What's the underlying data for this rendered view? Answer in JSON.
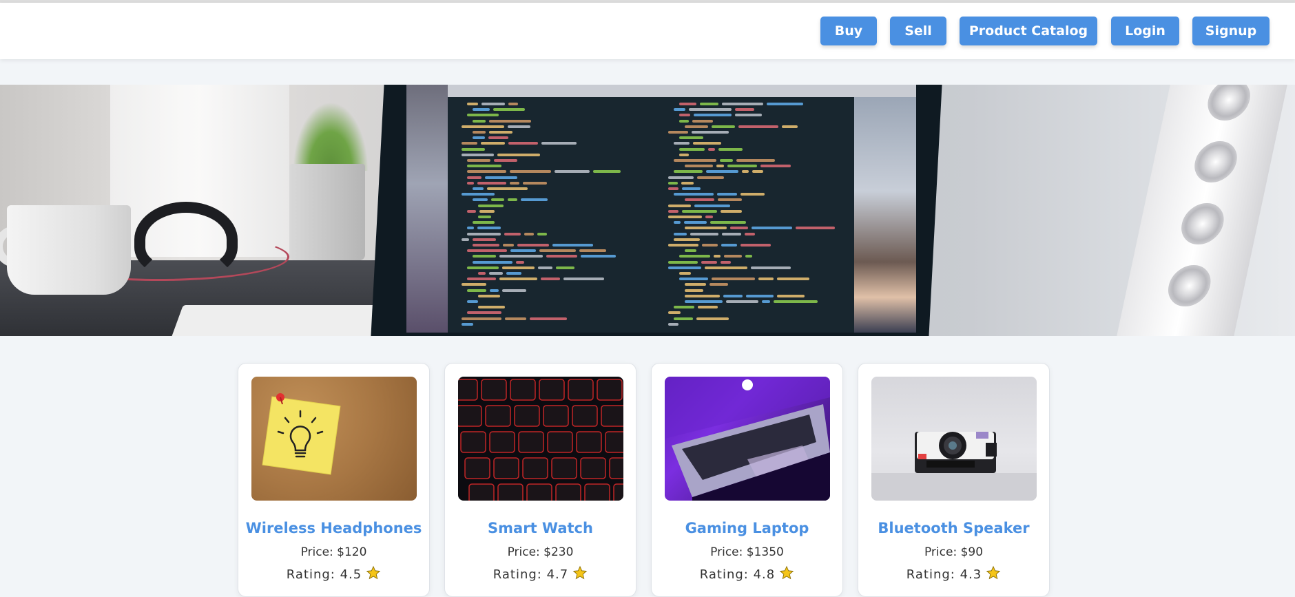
{
  "nav": {
    "buttons": [
      {
        "label": "Buy"
      },
      {
        "label": "Sell"
      },
      {
        "label": "Product Catalog"
      },
      {
        "label": "Login"
      },
      {
        "label": "Signup"
      }
    ]
  },
  "hero": {
    "image": "desk-with-laptop-showing-code-image"
  },
  "products": [
    {
      "name": "Wireless Headphones",
      "price": "Price: $120",
      "rating": "Rating: 4.5",
      "image": "lightbulb-sticky-note-image"
    },
    {
      "name": "Smart Watch",
      "price": "Price: $230",
      "rating": "Rating: 4.7",
      "image": "red-backlit-keyboard-image"
    },
    {
      "name": "Gaming Laptop",
      "price": "Price: $1350",
      "rating": "Rating: 4.8",
      "image": "purple-laptop-image"
    },
    {
      "name": "Bluetooth Speaker",
      "price": "Price: $90",
      "rating": "Rating: 4.3",
      "image": "instant-camera-image"
    }
  ],
  "colors": {
    "accent": "#4a90e2",
    "background": "#f2f5f8",
    "star": "#f5c518"
  },
  "icons": {
    "rating": "star-icon"
  }
}
